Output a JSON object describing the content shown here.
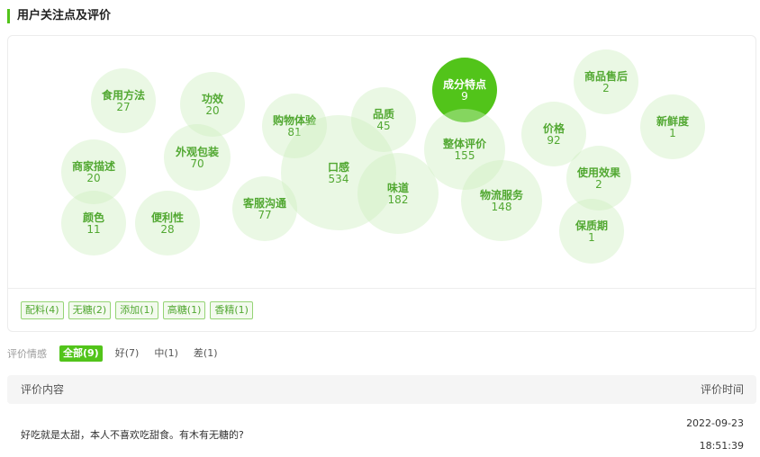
{
  "section_title": "用户关注点及评价",
  "bubbles": [
    {
      "name": "食用方法",
      "count": "27",
      "active": false
    },
    {
      "name": "功效",
      "count": "20",
      "active": false
    },
    {
      "name": "购物体验",
      "count": "81",
      "active": false
    },
    {
      "name": "品质",
      "count": "45",
      "active": false
    },
    {
      "name": "成分特点",
      "count": "9",
      "active": true
    },
    {
      "name": "商品售后",
      "count": "2",
      "active": false
    },
    {
      "name": "新鲜度",
      "count": "1",
      "active": false
    },
    {
      "name": "价格",
      "count": "92",
      "active": false
    },
    {
      "name": "整体评价",
      "count": "155",
      "active": false
    },
    {
      "name": "外观包装",
      "count": "70",
      "active": false
    },
    {
      "name": "商家描述",
      "count": "20",
      "active": false
    },
    {
      "name": "口感",
      "count": "534",
      "active": false
    },
    {
      "name": "味道",
      "count": "182",
      "active": false
    },
    {
      "name": "使用效果",
      "count": "2",
      "active": false
    },
    {
      "name": "物流服务",
      "count": "148",
      "active": false
    },
    {
      "name": "客服沟通",
      "count": "77",
      "active": false
    },
    {
      "name": "颜色",
      "count": "11",
      "active": false
    },
    {
      "name": "便利性",
      "count": "28",
      "active": false
    },
    {
      "name": "保质期",
      "count": "1",
      "active": false
    }
  ],
  "tags": [
    "配料(4)",
    "无糖(2)",
    "添加(1)",
    "高糖(1)",
    "香精(1)"
  ],
  "filter": {
    "label": "评价情感",
    "options": [
      {
        "label": "全部(9)",
        "active": true
      },
      {
        "label": "好(7)",
        "active": false
      },
      {
        "label": "中(1)",
        "active": false
      },
      {
        "label": "差(1)",
        "active": false
      }
    ]
  },
  "table": {
    "header_content": "评价内容",
    "header_time": "评价时间",
    "rows": [
      {
        "content": "好吃就是太甜，本人不喜欢吃甜食。有木有无糖的?",
        "date": "2022-09-23",
        "time": "18:51:39"
      }
    ]
  },
  "colors": {
    "accent": "#52c41a",
    "bubble_text": "#52a832",
    "bubble_fill": "#d6f0c8"
  }
}
